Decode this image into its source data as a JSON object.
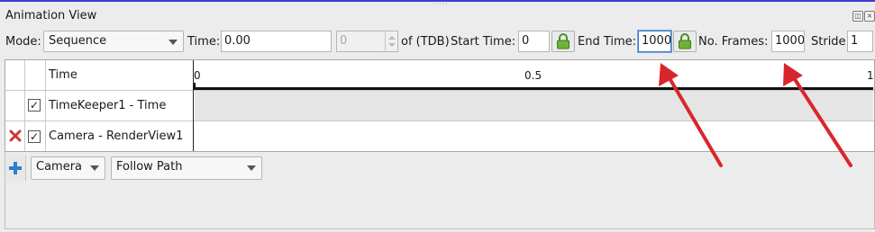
{
  "panel": {
    "title": "Animation View"
  },
  "toolbar": {
    "mode_label": "Mode:",
    "mode_value": "Sequence",
    "time_label": "Time:",
    "time_value": "0.00",
    "timestep_value": "0",
    "of_tdb_label": "of (TDB)",
    "start_time_label": "Start Time:",
    "start_time_value": "0",
    "end_time_label": "End Time:",
    "end_time_value": "1000",
    "frames_label": "No. Frames:",
    "frames_value": "1000",
    "stride_label": "Stride",
    "stride_value": "1"
  },
  "table": {
    "header": {
      "time_label": "Time"
    },
    "ticks": [
      "0",
      "0.5",
      "1"
    ],
    "rows": [
      {
        "label": "TimeKeeper1 - Time",
        "checked": true
      },
      {
        "label": "Camera - RenderView1",
        "checked": true
      }
    ]
  },
  "add_track": {
    "source_value": "Camera",
    "mode_value": "Follow Path"
  },
  "colors": {
    "annotation_arrow": "#d9262c",
    "lock_icon": "#5aa02c",
    "add_icon": "#2d7fd0",
    "delete_icon": "#d2362e"
  },
  "icons": {
    "lock": "lock-icon",
    "add": "plus-icon",
    "delete": "close-icon",
    "dropdown": "chevron-down-icon",
    "arrow": "annotation-arrow-icon"
  }
}
